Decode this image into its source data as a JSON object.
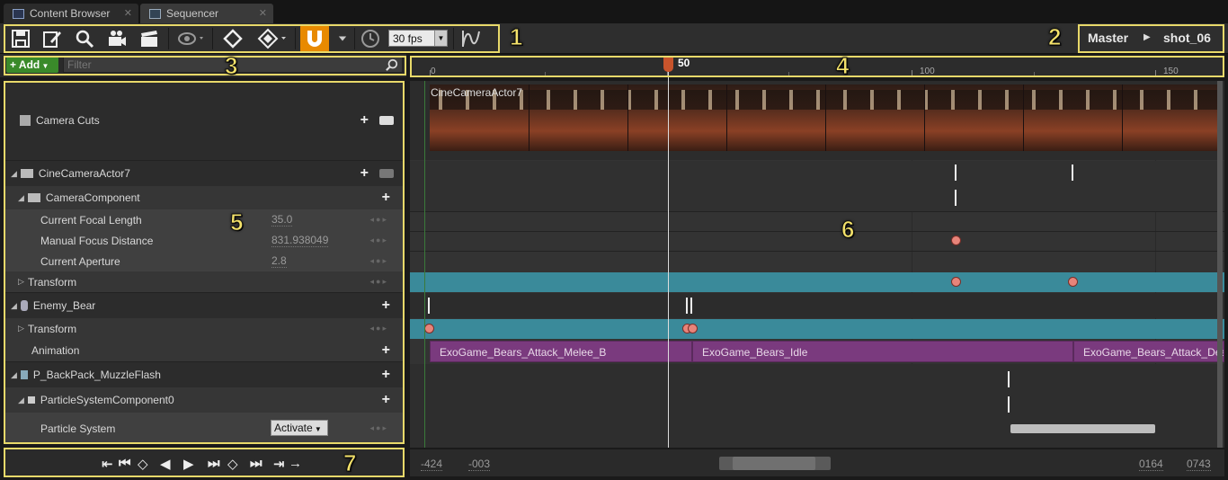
{
  "tabs": [
    {
      "label": "Content Browser",
      "active": false,
      "icon": "content-browser-icon"
    },
    {
      "label": "Sequencer",
      "active": true,
      "icon": "sequencer-icon"
    }
  ],
  "toolbar": {
    "fps_value": "30 fps",
    "breadcrumb_master": "Master",
    "breadcrumb_shot": "shot_06"
  },
  "callouts": [
    "1",
    "2",
    "3",
    "4",
    "5",
    "6",
    "7"
  ],
  "filter": {
    "add_label": "Add",
    "placeholder": "Filter"
  },
  "ruler": {
    "ticks": [
      "0",
      "50",
      "50",
      "100",
      "150"
    ]
  },
  "outliner": {
    "camera_cuts": "Camera Cuts",
    "cine_actor": "CineCameraActor7",
    "camera_component": "CameraComponent",
    "focal_length_label": "Current Focal Length",
    "focal_length_value": "35.0",
    "focus_distance_label": "Manual Focus Distance",
    "focus_distance_value": "831.938049",
    "aperture_label": "Current Aperture",
    "aperture_value": "2.8",
    "transform1": "Transform",
    "enemy_bear": "Enemy_Bear",
    "transform2": "Transform",
    "animation": "Animation",
    "backpack": "P_BackPack_MuzzleFlash",
    "particle_component": "ParticleSystemComponent0",
    "particle_system": "Particle System",
    "activate_label": "Activate"
  },
  "timeline": {
    "camera_track_label": "CineCameraActor7",
    "anim_sections": [
      "ExoGame_Bears_Attack_Melee_B",
      "ExoGame_Bears_Idle",
      "ExoGame_Bears_Attack_Dea"
    ]
  },
  "bottom": {
    "range_start": "-424",
    "view_start": "-003",
    "view_end": "0164",
    "range_end": "0743"
  },
  "colors": {
    "accent": "#e88a00",
    "add_green": "#3a8a2a",
    "transform_teal": "#3a8a9a",
    "anim_purple": "#7a3a7e",
    "callout": "#e8d96a"
  }
}
